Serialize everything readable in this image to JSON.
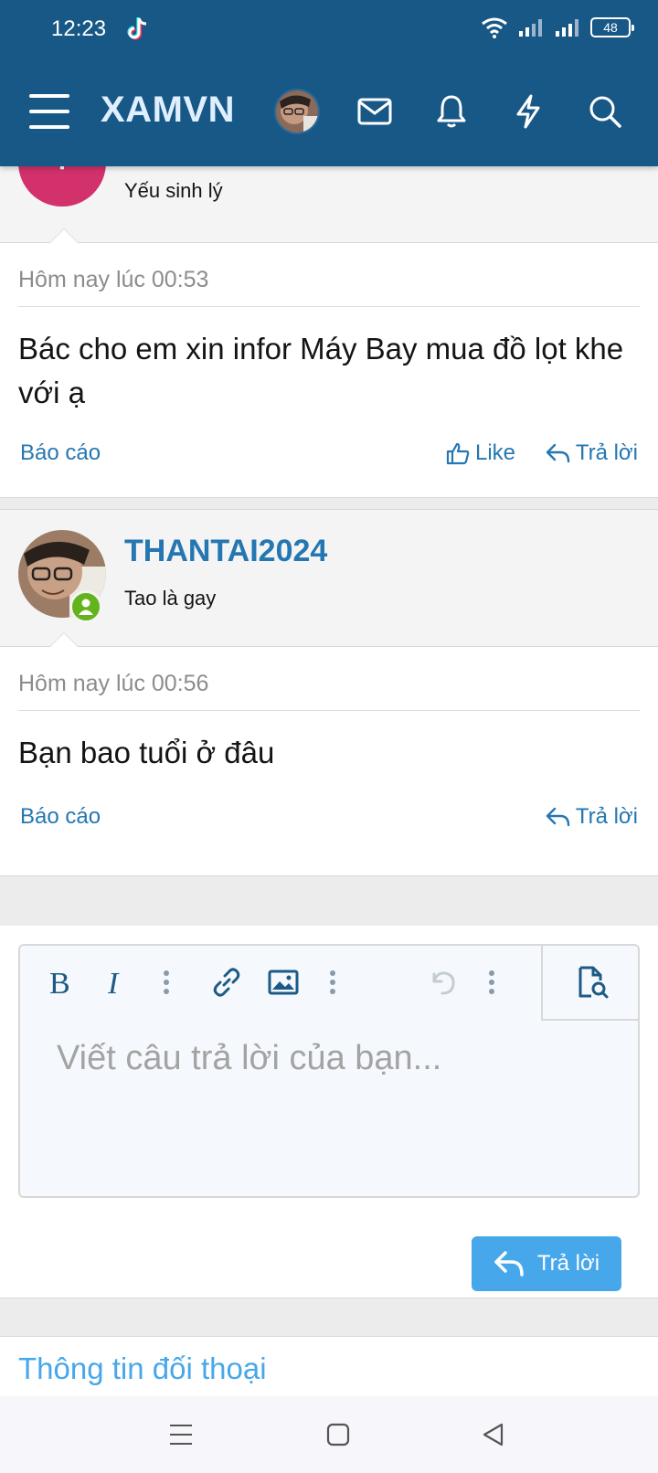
{
  "status_bar": {
    "time": "12:23",
    "battery": "48"
  },
  "header": {
    "logo": "XAMVN"
  },
  "posts": [
    {
      "user_title": "Yếu sinh lý",
      "avatar_letter": "T",
      "date": "Hôm nay lúc 00:53",
      "body": "Bác cho em xin infor Máy Bay mua đồ lọt khe với ạ",
      "report": "Báo cáo",
      "like": "Like",
      "reply": "Trả lời"
    },
    {
      "username": "THANTAI2024",
      "user_title": "Tao là gay",
      "date": "Hôm nay lúc 00:56",
      "body": "Bạn bao tuổi ở đâu",
      "report": "Báo cáo",
      "reply": "Trả lời"
    }
  ],
  "editor": {
    "placeholder": "Viết câu trả lời của bạn...",
    "submit": "Trả lời"
  },
  "footer": {
    "info_title": "Thông tin đối thoại"
  },
  "colors": {
    "header": "#185886",
    "link": "#2577b1",
    "button": "#47a7eb",
    "avatar": "#d2316c",
    "online": "#63b31d"
  }
}
